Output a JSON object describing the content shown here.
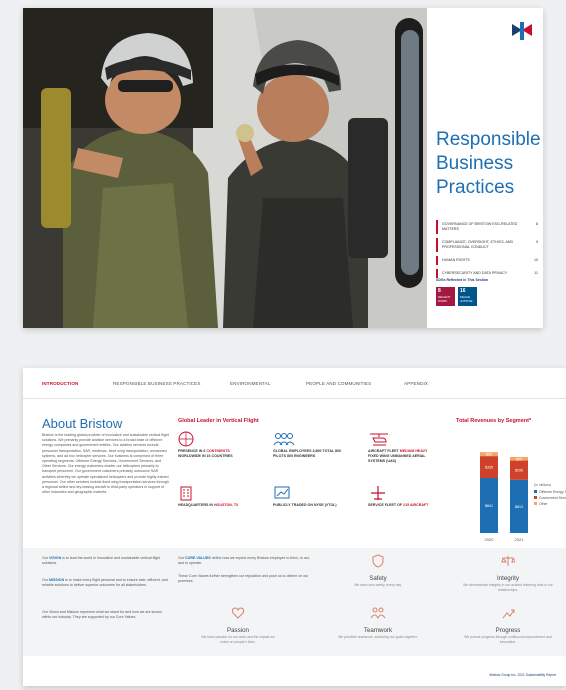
{
  "spread1": {
    "title_lines": [
      "Responsible",
      "Business",
      "Practices"
    ],
    "toc": [
      {
        "label": "GOVERNANCE OF BRISTOW ESG-RELATED MATTERS",
        "page": "8"
      },
      {
        "label": "COMPLIANCE, OVERSIGHT, ETHICS, AND PROFESSIONAL CONDUCT",
        "page": "9"
      },
      {
        "label": "HUMAN RIGHTS",
        "page": "10"
      },
      {
        "label": "CYBERSECURITY AND DATA PRIVACY",
        "page": "11"
      }
    ],
    "sdg_label": "SDGs Reflected in This Section",
    "sdgs": [
      {
        "num": "8",
        "label": "DECENT WORK",
        "color": "#a21942"
      },
      {
        "num": "16",
        "label": "PEACE JUSTICE",
        "color": "#00558b"
      }
    ]
  },
  "spread2": {
    "nav": [
      "INTRODUCTION",
      "RESPONSIBLE BUSINESS PRACTICES",
      "ENVIRONMENTAL",
      "PEOPLE AND COMMUNITIES",
      "APPENDIX"
    ],
    "about_title": "About Bristow",
    "about_text": "Bristow is the leading global provider of innovative and sustainable vertical flight solutions. We primarily provide aviation services to a broad base of offshore energy companies and government entities. Our aviation services include personnel transportation, SAR, medevac, fixed wing transportation, unmanned systems, and ad hoc helicopter services. Our business is comprised of three operating segments: Offshore Energy Services, Government Services, and Other Services. Our energy customers charter our helicopters primarily to transport personnel. Our government customers primarily outsource SAR activities whereby we operate specialized helicopters and provide highly trained personnel. Our other services include fixed wing transportation services through a regional airline and dry-leasing aircraft to third-party operators in support of other industries and geographic markets.",
    "global_title": "Global Leader in Vertical Flight",
    "stats": [
      {
        "pre": "PRESENCE IN 6 ",
        "hl": "CONTINENTS",
        "post": " WORLDWIDE IN 16 COUNTRIES"
      },
      {
        "pre": "GLOBAL EMPLOYEES 3,800 TOTAL 800 PILOTS 800 ENGINEERS",
        "hl": "",
        "post": ""
      },
      {
        "pre": "AIRCRAFT FLEET ",
        "hl": "MEDIUM HEAVY",
        "post": " FIXED WING UNMANNED AERIAL SYSTEMS (UAS)"
      },
      {
        "pre": "HEADQUARTERS IN ",
        "hl": "HOUSTON, TX",
        "post": ""
      },
      {
        "pre": "PUBLICLY TRADED ON NYSE (VTOL)",
        "hl": "",
        "post": ""
      },
      {
        "pre": "SERVICE FLEET OF ",
        "hl": "215 AIRCRAFT",
        "post": ""
      }
    ],
    "revenue_title": "Total Revenues by Segment*",
    "chart_data": {
      "type": "bar",
      "stacked": true,
      "categories": [
        "2020",
        "2021"
      ],
      "series": [
        {
          "name": "Offshore Energy Services",
          "values": [
            841,
            813
          ],
          "color": "#1d6fb3"
        },
        {
          "name": "Government Services",
          "values": [
            335,
            295
          ],
          "color": "#d0412c"
        },
        {
          "name": "Other",
          "values": [
            60,
            55
          ],
          "color": "#f0a868"
        }
      ],
      "bar_labels": [
        [
          "$841",
          "$335",
          "$60"
        ],
        [
          "$813",
          "$295",
          "$55"
        ]
      ],
      "legend_title": "(in millions)",
      "legend_position": "right"
    },
    "vision": {
      "pre": "Our ",
      "key": "VISION",
      "post": " is to lead the world in innovative and sustainable vertical flight solutions."
    },
    "mission": {
      "pre": "Our ",
      "key": "MISSION",
      "post": " is to make every flight personal and to ensure safe, efficient, and reliable solutions to deliver superior outcomes for all stakeholders."
    },
    "vision_mission_note": "Our Vision and Mission represent what we stand for and how we are known within our industry. They are supported by our Core Values.",
    "core_values_intro": {
      "pre": "Our ",
      "key": "CORE VALUES",
      "post": " define how we expect every Bristow employee to think, to act, and to operate."
    },
    "core_values_note": "These Core Values further strengthen our reputation and push us to deliver on our promises.",
    "values": [
      {
        "name": "Safety",
        "desc": "We each own safety, every day."
      },
      {
        "name": "Integrity",
        "desc": "We demonstrate integrity in our actions fostering trust in our relationships."
      },
      {
        "name": "Passion",
        "desc": "We have passion for our work and the impact we make on people's lives."
      },
      {
        "name": "Teamwork",
        "desc": "We prioritize teamwork, achieving our goals together."
      },
      {
        "name": "Progress",
        "desc": "We pursue progress through continuous improvement and innovation."
      }
    ],
    "footer": "Bristow Group Inc. 2021 Sustainability Report"
  }
}
